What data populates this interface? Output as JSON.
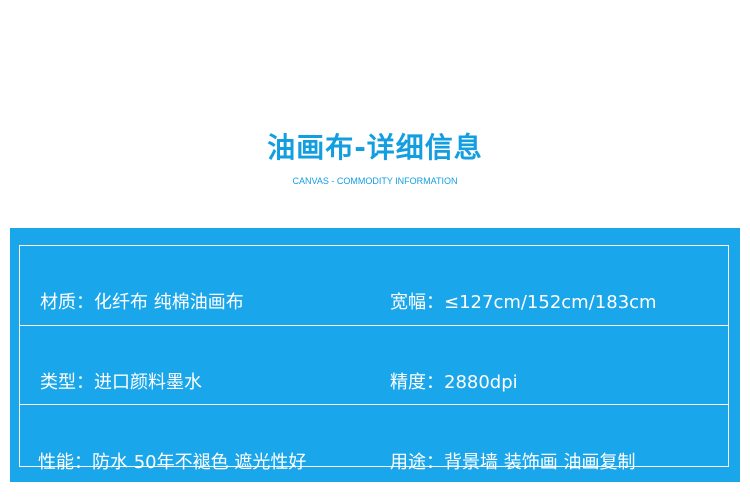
{
  "header": {
    "title": "油画布-详细信息",
    "subtitle": "CANVAS - COMMODITY INFORMATION"
  },
  "specs": [
    {
      "left": {
        "label": "材质：",
        "value": "化纤布 纯棉油画布"
      },
      "right": {
        "label": "宽幅：",
        "value": "≤127cm/152cm/183cm"
      }
    },
    {
      "left": {
        "label": "类型：",
        "value": "进口颜料墨水"
      },
      "right": {
        "label": "精度：",
        "value": "2880dpi"
      }
    },
    {
      "left": {
        "label": "性能：",
        "value": "防水 50年不褪色 遮光性好"
      },
      "right": {
        "label": "用途：",
        "value": "背景墙 装饰画 油画复制"
      }
    }
  ],
  "colors": {
    "accent": "#139ee0",
    "panel": "#1aa6ea",
    "text_on_panel": "#ffffff"
  }
}
